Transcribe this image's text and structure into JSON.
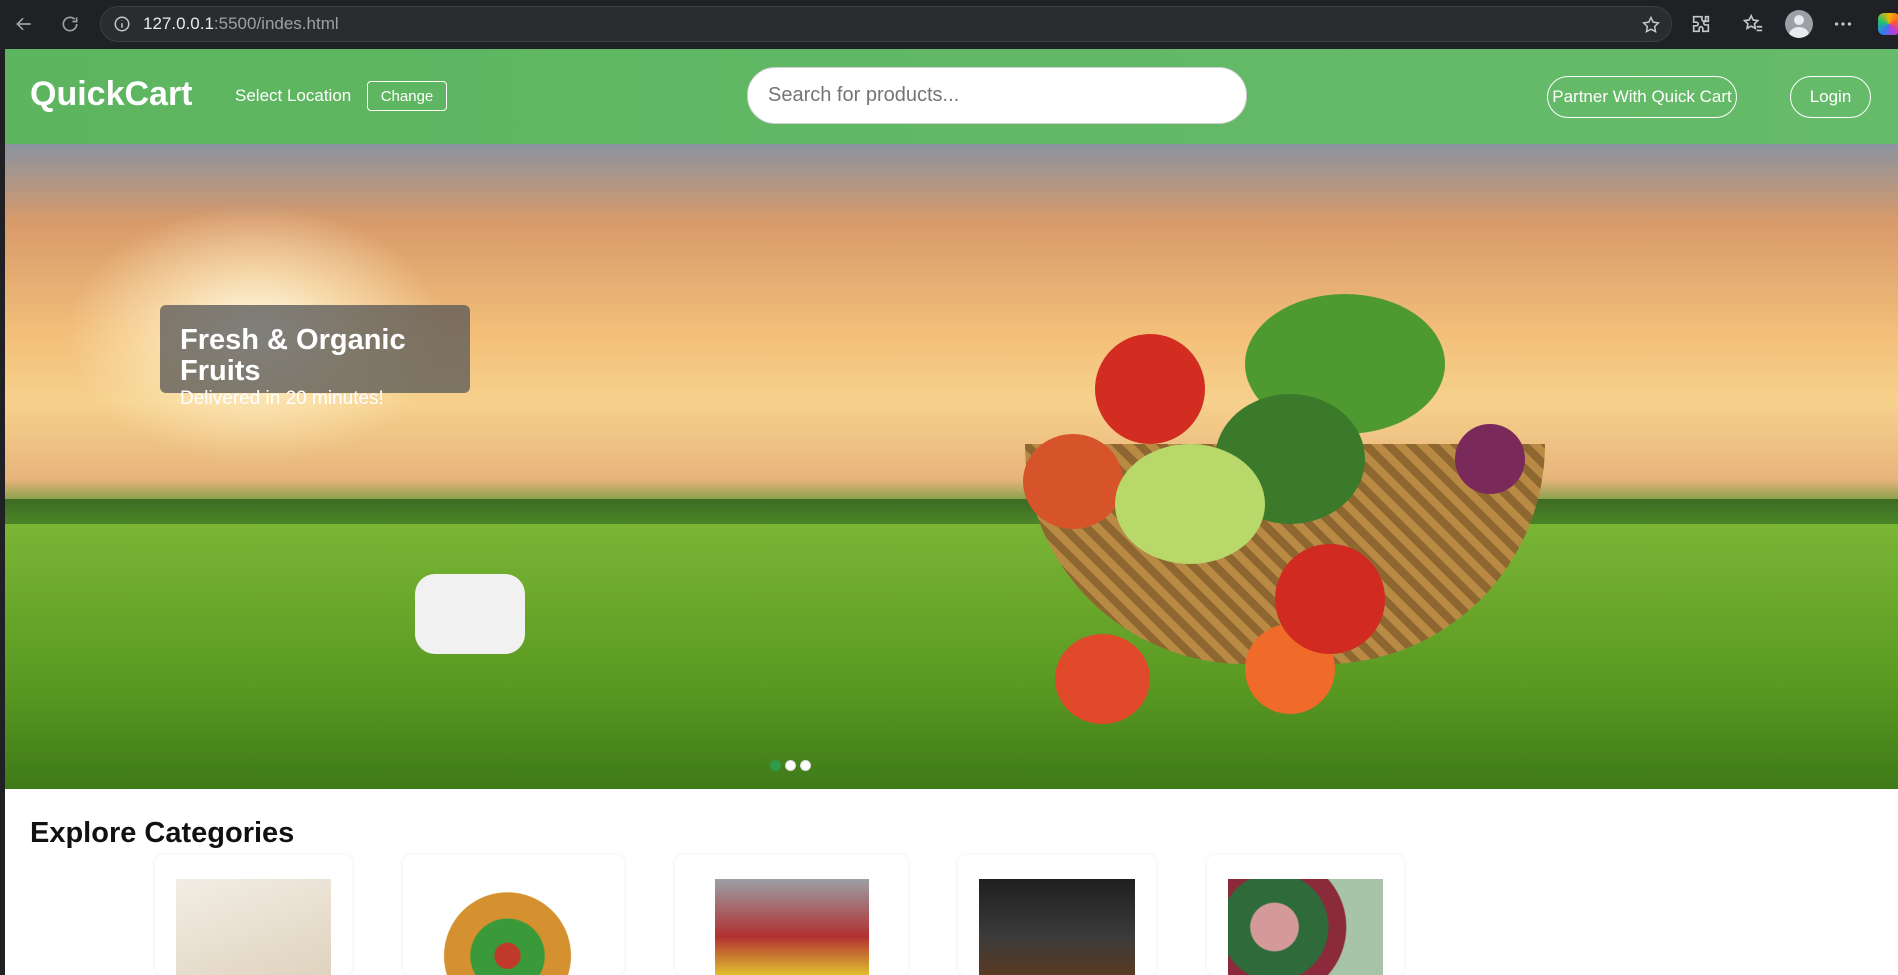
{
  "browser": {
    "url_host": "127.0.0.1",
    "url_path": ":5500/indes.html"
  },
  "header": {
    "logo": "QuickCart",
    "location_label": "Select Location",
    "change_label": "Change",
    "search_placeholder": "Search for products...",
    "partner_label": "Partner With Quick Cart",
    "login_label": "Login"
  },
  "hero": {
    "title": "Fresh & Organic Fruits",
    "subtitle": "Delivered in 20 minutes!",
    "active_slide": 1,
    "slide_count": 3
  },
  "categories": {
    "title": "Explore Categories"
  },
  "colors": {
    "header_green": "#5db55f",
    "active_dot": "#2e9a4a"
  }
}
